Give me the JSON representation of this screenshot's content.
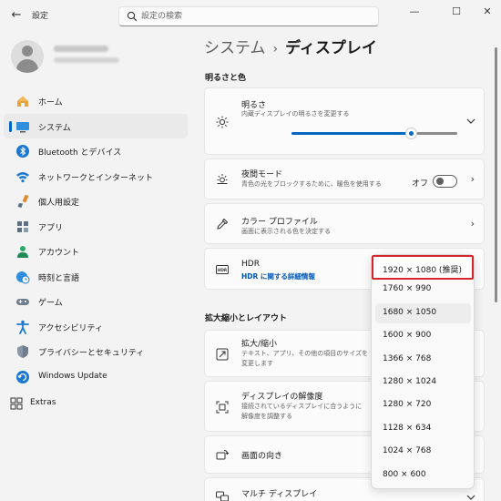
{
  "window": {
    "title": "設定",
    "minimize": "—",
    "maximize": "☐",
    "close": "✕"
  },
  "search": {
    "placeholder": "設定の検索",
    "value": ""
  },
  "profile": {
    "name": "",
    "email": ""
  },
  "sidebar": {
    "items": [
      {
        "label": "ホーム",
        "icon": "home-icon"
      },
      {
        "label": "システム",
        "icon": "system-monitor-icon",
        "active": true
      },
      {
        "label": "Bluetooth とデバイス",
        "icon": "bluetooth-icon"
      },
      {
        "label": "ネットワークとインターネット",
        "icon": "wifi-icon"
      },
      {
        "label": "個人用設定",
        "icon": "brush-icon"
      },
      {
        "label": "アプリ",
        "icon": "apps-icon"
      },
      {
        "label": "アカウント",
        "icon": "account-icon"
      },
      {
        "label": "時刻と言語",
        "icon": "globe-clock-icon"
      },
      {
        "label": "ゲーム",
        "icon": "gamepad-icon"
      },
      {
        "label": "アクセシビリティ",
        "icon": "accessibility-icon"
      },
      {
        "label": "プライバシーとセキュリティ",
        "icon": "shield-icon"
      },
      {
        "label": "Windows Update",
        "icon": "update-icon"
      }
    ],
    "extras": {
      "label": "Extras",
      "icon": "extras-icon"
    }
  },
  "breadcrumb": {
    "parent": "システム",
    "separator": "›",
    "current": "ディスプレイ"
  },
  "sections": {
    "brightness_color": "明るさと色",
    "scale_layout": "拡大縮小とレイアウト"
  },
  "cards": {
    "brightness": {
      "title": "明るさ",
      "subtitle": "内蔵ディスプレイの明るさを変更する",
      "value": 0.72
    },
    "night_light": {
      "title": "夜間モード",
      "subtitle": "青色の光をブロックするために、暖色を使用する",
      "state_label": "オフ",
      "on": false
    },
    "color_profile": {
      "title": "カラー プロファイル",
      "subtitle": "画面に表示される色を決定する"
    },
    "hdr": {
      "title": "HDR",
      "link": "HDR に関する詳細情報"
    },
    "scale": {
      "title": "拡大/縮小",
      "subtitle_line1": "テキスト、アプリ、その他の項目のサイズを",
      "subtitle_line2": "変更します"
    },
    "resolution": {
      "title": "ディスプレイの解像度",
      "subtitle_line1": "接続されているディスプレイに合うように",
      "subtitle_line2": "解像度を調整する"
    },
    "orientation": {
      "title": "画面の向き"
    },
    "multi_display": {
      "title": "マルチ ディスプレイ"
    }
  },
  "resolution_dropdown": {
    "selected_index": 0,
    "hover_index": 2,
    "options": [
      "1920 × 1080 (推奨)",
      "1760 × 990",
      "1680 × 1050",
      "1600 × 900",
      "1366 × 768",
      "1280 × 1024",
      "1280 × 720",
      "1128 × 634",
      "1024 × 768",
      "800 × 600"
    ]
  },
  "colors": {
    "accent": "#0067c0",
    "highlight_border": "#d4262c",
    "background": "#f3f3f3",
    "card": "#fbfbfb"
  }
}
